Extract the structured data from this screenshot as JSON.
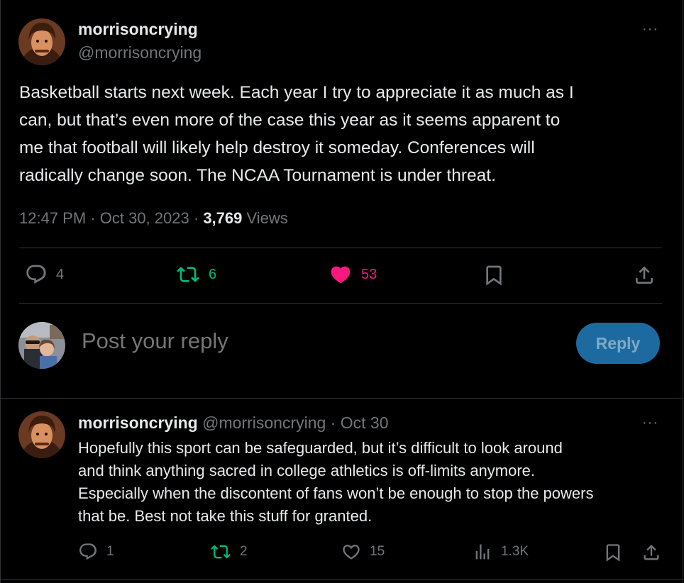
{
  "tweet": {
    "display_name": "morrisoncrying",
    "handle": "@morrisoncrying",
    "more": "···",
    "text_lines": [
      "Basketball starts next week. Each year I try to appreciate it as much as I",
      "can, but that’s even more of the case this year as it seems apparent to",
      "me that football will likely help destroy it someday. Conferences will",
      "radically change soon. The NCAA Tournament is under threat."
    ],
    "time": "12:47 PM",
    "date": "Oct 30, 2023",
    "views_count": "3,769",
    "views_label": "Views",
    "replies": "4",
    "reposts": "6",
    "likes": "53"
  },
  "reply_box": {
    "placeholder": "Post your reply",
    "button_label": "Reply"
  },
  "reply": {
    "display_name": "morrisoncrying",
    "handle": "@morrisoncrying",
    "date": "Oct 30",
    "more": "···",
    "text_lines": [
      "Hopefully this sport can be safeguarded, but it’s difficult to look around",
      "and think anything sacred in college athletics is off-limits anymore.",
      "Especially when the discontent of fans won’t be enough to stop the powers",
      "that be. Best not take this stuff for granted."
    ],
    "replies": "1",
    "reposts": "2",
    "likes": "15",
    "views": "1.3K"
  },
  "colors": {
    "background": "#000000",
    "text": "#e7e9ea",
    "muted": "#71767b",
    "repost_green": "#00ba7c",
    "like_pink": "#f91880",
    "reply_button": "#1d6aa0"
  },
  "icons": [
    "reply-icon",
    "repost-icon",
    "heart-filled-icon",
    "heart-icon",
    "bookmark-icon",
    "share-icon",
    "views-icon",
    "more-icon"
  ]
}
